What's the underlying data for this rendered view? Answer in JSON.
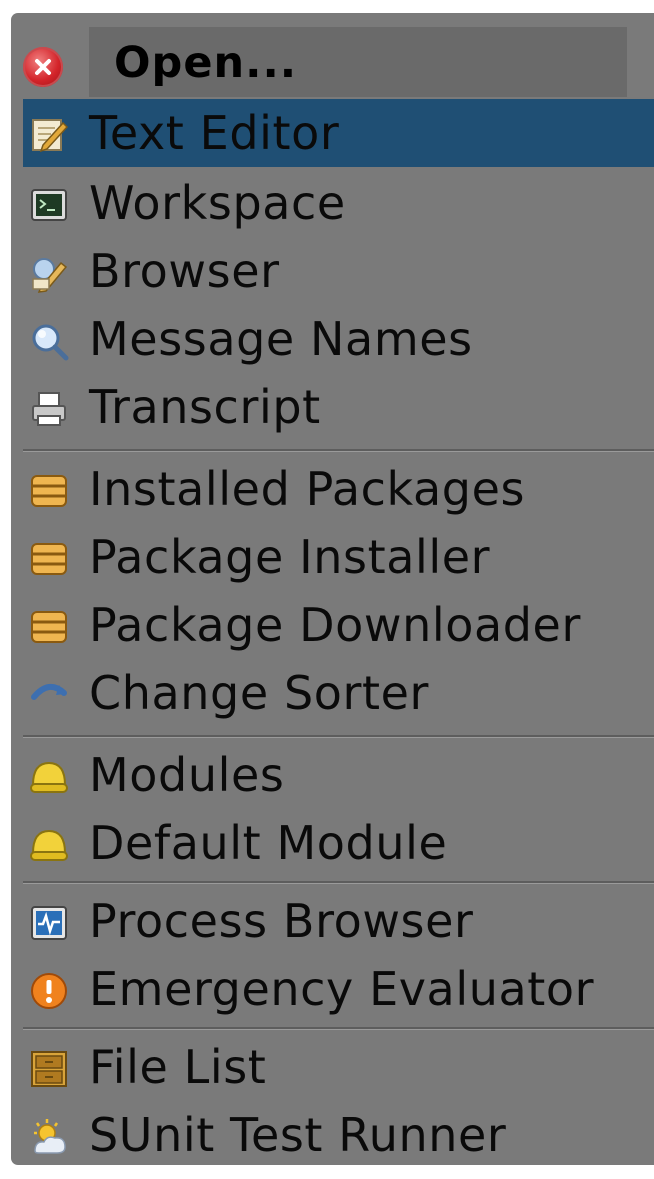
{
  "menu": {
    "title": "Open...",
    "items": [
      {
        "label": "Text Editor",
        "icon": "text-editor-icon",
        "selected": true
      },
      {
        "label": "Workspace",
        "icon": "workspace-icon"
      },
      {
        "label": "Browser",
        "icon": "browser-icon"
      },
      {
        "label": "Message Names",
        "icon": "magnifier-icon"
      },
      {
        "label": "Transcript",
        "icon": "printer-icon"
      },
      {
        "label": "Installed Packages",
        "icon": "package-icon"
      },
      {
        "label": "Package Installer",
        "icon": "package-icon"
      },
      {
        "label": "Package Downloader",
        "icon": "package-icon"
      },
      {
        "label": "Change Sorter",
        "icon": "change-sorter-icon"
      },
      {
        "label": "Modules",
        "icon": "module-icon"
      },
      {
        "label": "Default Module",
        "icon": "module-icon"
      },
      {
        "label": "Process Browser",
        "icon": "process-icon"
      },
      {
        "label": "Emergency Evaluator",
        "icon": "warning-icon"
      },
      {
        "label": "File List",
        "icon": "file-list-icon"
      },
      {
        "label": "SUnit Test Runner",
        "icon": "sunit-icon"
      }
    ]
  },
  "colors": {
    "menu_background": "#7a7a7a",
    "title_background": "#6a6a6a",
    "selection": "#1f4f74",
    "close_button": "#d4242a"
  }
}
